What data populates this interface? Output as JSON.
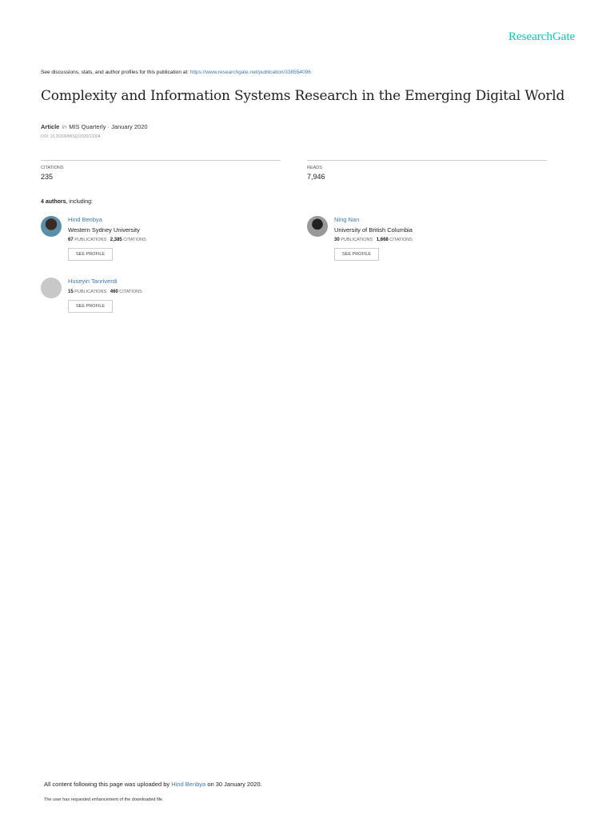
{
  "brand": "ResearchGate",
  "disclaimer": {
    "text": "See discussions, stats, and author profiles for this publication at: ",
    "url": "https://www.researchgate.net/publication/338554096"
  },
  "title": "Complexity and Information Systems Research in the Emerging Digital World",
  "meta": {
    "type": "Article",
    "in": "in",
    "journal": "MIS Quarterly · January 2020",
    "doi": "DOI: 10.25300/MISQ/2020/13304"
  },
  "stats": [
    {
      "label": "CITATIONS",
      "value": "235"
    },
    {
      "label": "READS",
      "value": "7,946"
    }
  ],
  "authors_heading": {
    "count": "4 authors",
    "suffix": ", including:"
  },
  "authors": [
    {
      "name": "Hind Benbya",
      "institution": "Western Sydney University",
      "publications": "67",
      "citations": "2,385",
      "pub_label": "PUBLICATIONS",
      "cit_label": "CITATIONS",
      "button": "SEE PROFILE"
    },
    {
      "name": "Ning Nan",
      "institution": "University of British Columbia",
      "publications": "30",
      "citations": "1,668",
      "pub_label": "PUBLICATIONS",
      "cit_label": "CITATIONS",
      "button": "SEE PROFILE"
    },
    {
      "name": "Huseyin Tanriverdi",
      "institution": "",
      "publications": "15",
      "citations": "460",
      "pub_label": "PUBLICATIONS",
      "cit_label": "CITATIONS",
      "button": "SEE PROFILE"
    }
  ],
  "footer": {
    "prefix": "All content following this page was uploaded by ",
    "uploader": "Hind Benbya",
    "suffix": " on 30 January 2020.",
    "note": "The user has requested enhancement of the downloaded file."
  }
}
